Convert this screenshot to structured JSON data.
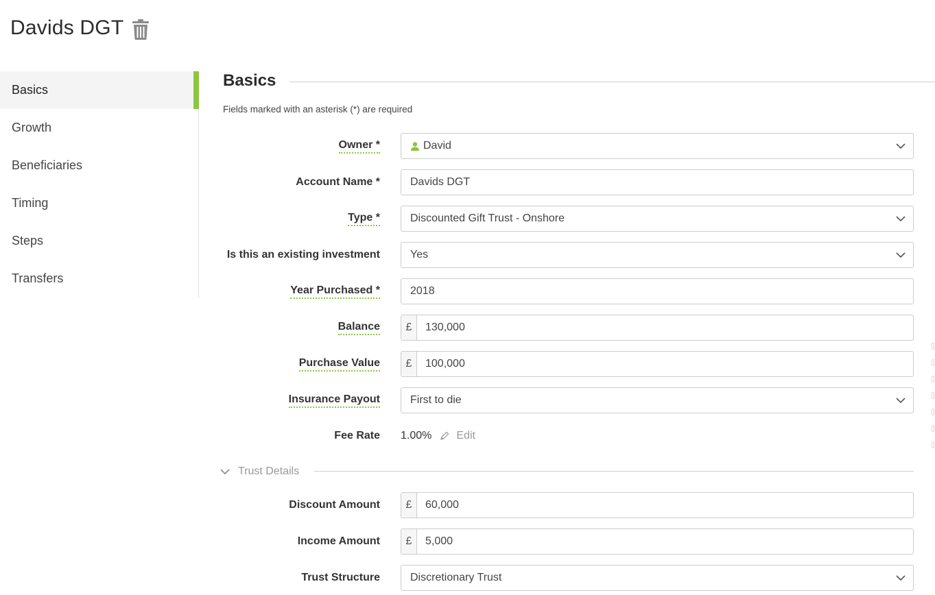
{
  "page": {
    "title": "Davids DGT",
    "delete_icon": "trash-icon"
  },
  "sidebar": {
    "items": [
      {
        "label": "Basics",
        "active": true
      },
      {
        "label": "Growth"
      },
      {
        "label": "Beneficiaries"
      },
      {
        "label": "Timing"
      },
      {
        "label": "Steps"
      },
      {
        "label": "Transfers"
      }
    ]
  },
  "section": {
    "title": "Basics",
    "required_note": "Fields marked with an asterisk (*) are required"
  },
  "form": {
    "owner": {
      "label": "Owner *",
      "value": "David"
    },
    "account_name": {
      "label": "Account Name *",
      "value": "Davids DGT"
    },
    "type": {
      "label": "Type *",
      "value": "Discounted Gift Trust - Onshore"
    },
    "existing_investment": {
      "label": "Is this an existing investment",
      "value": "Yes"
    },
    "year_purchased": {
      "label": "Year Purchased *",
      "value": "2018"
    },
    "balance": {
      "label": "Balance",
      "currency": "£",
      "value": "130,000"
    },
    "purchase_value": {
      "label": "Purchase Value",
      "currency": "£",
      "value": "100,000"
    },
    "insurance_payout": {
      "label": "Insurance Payout",
      "value": "First to die"
    },
    "fee_rate": {
      "label": "Fee Rate",
      "value": "1.00%",
      "edit_label": "Edit"
    }
  },
  "trust_details": {
    "title": "Trust Details",
    "discount_amount": {
      "label": "Discount Amount",
      "currency": "£",
      "value": "60,000"
    },
    "income_amount": {
      "label": "Income Amount",
      "currency": "£",
      "value": "5,000"
    },
    "trust_structure": {
      "label": "Trust Structure",
      "value": "Discretionary Trust"
    }
  },
  "colors": {
    "accent": "#8cc63f",
    "border": "#cccccc",
    "muted": "#999999"
  }
}
